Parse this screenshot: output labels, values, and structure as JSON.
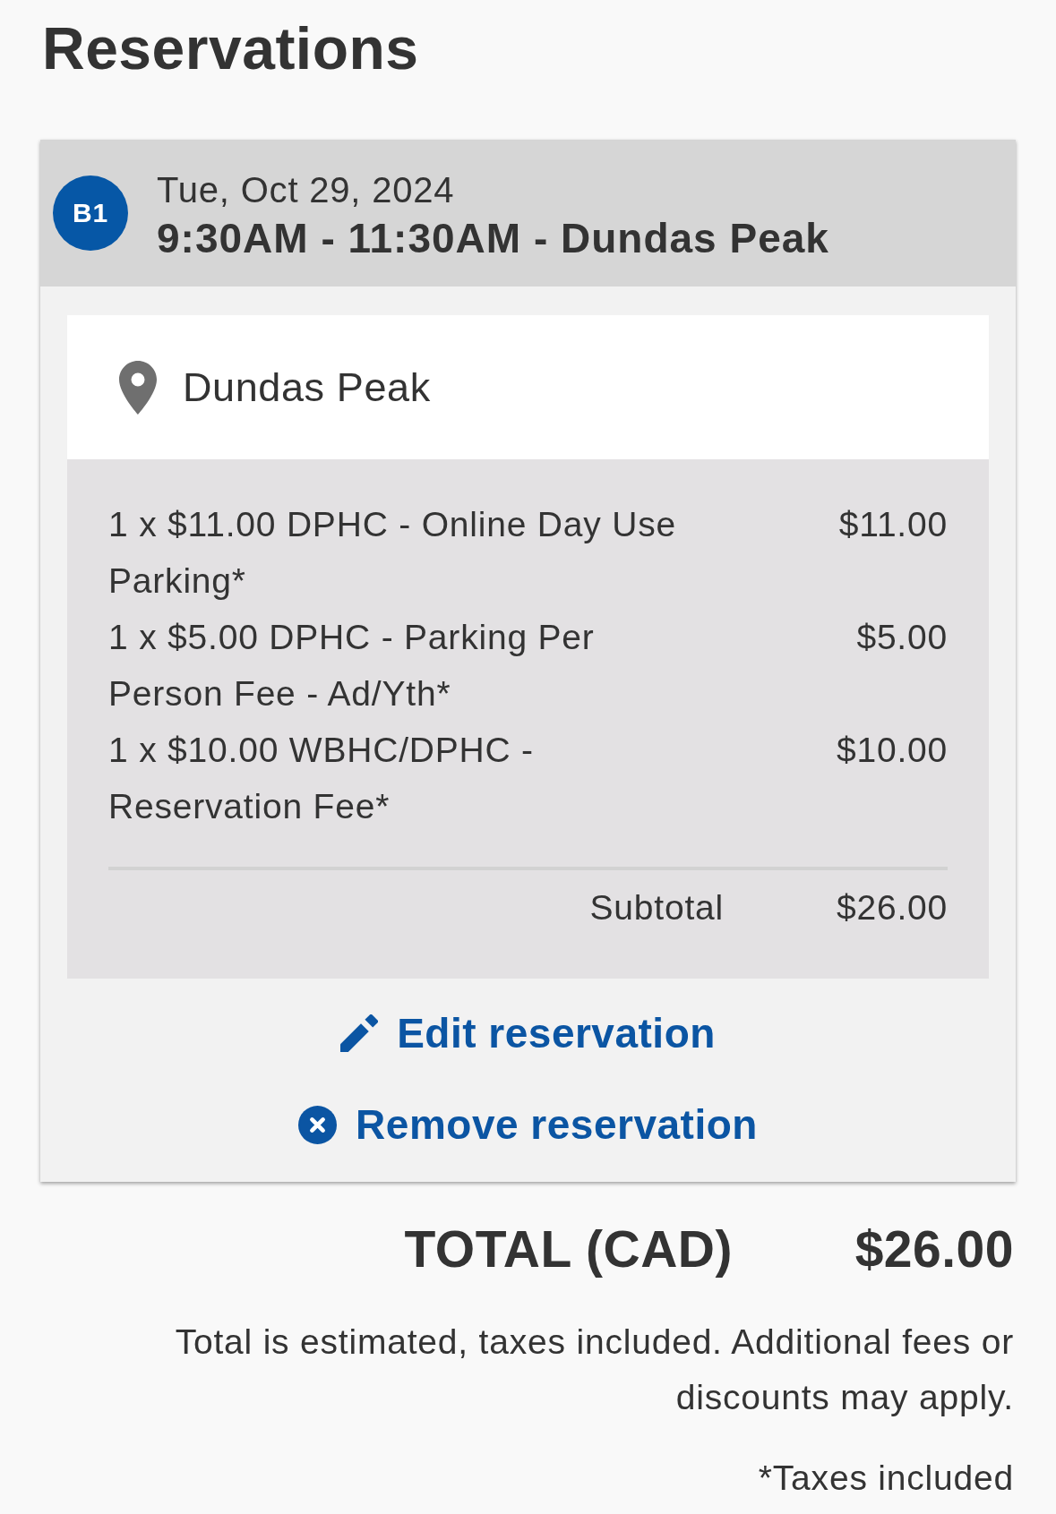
{
  "page": {
    "title": "Reservations"
  },
  "reservations": [
    {
      "badge": "B1",
      "date": "Tue, Oct 29, 2024",
      "time_and_place": "9:30AM - 11:30AM - Dundas Peak",
      "location": "Dundas Peak",
      "line_items": [
        {
          "description": "1 x $11.00 DPHC - Online Day Use Parking*",
          "amount": "$11.00"
        },
        {
          "description": "1 x $5.00 DPHC - Parking Per Person Fee - Ad/Yth*",
          "amount": "$5.00"
        },
        {
          "description": "1 x $10.00 WBHC/DPHC - Reservation Fee*",
          "amount": "$10.00"
        }
      ],
      "subtotal": {
        "label": "Subtotal",
        "amount": "$26.00"
      },
      "actions": [
        {
          "kind": "edit",
          "label": "Edit reservation"
        },
        {
          "kind": "remove",
          "label": "Remove reservation"
        }
      ]
    }
  ],
  "total": {
    "label": "TOTAL (CAD)",
    "amount": "$26.00"
  },
  "estimate_note": "Total is estimated, taxes included. Additional fees or discounts may apply.",
  "tax_note": "*Taxes included"
}
